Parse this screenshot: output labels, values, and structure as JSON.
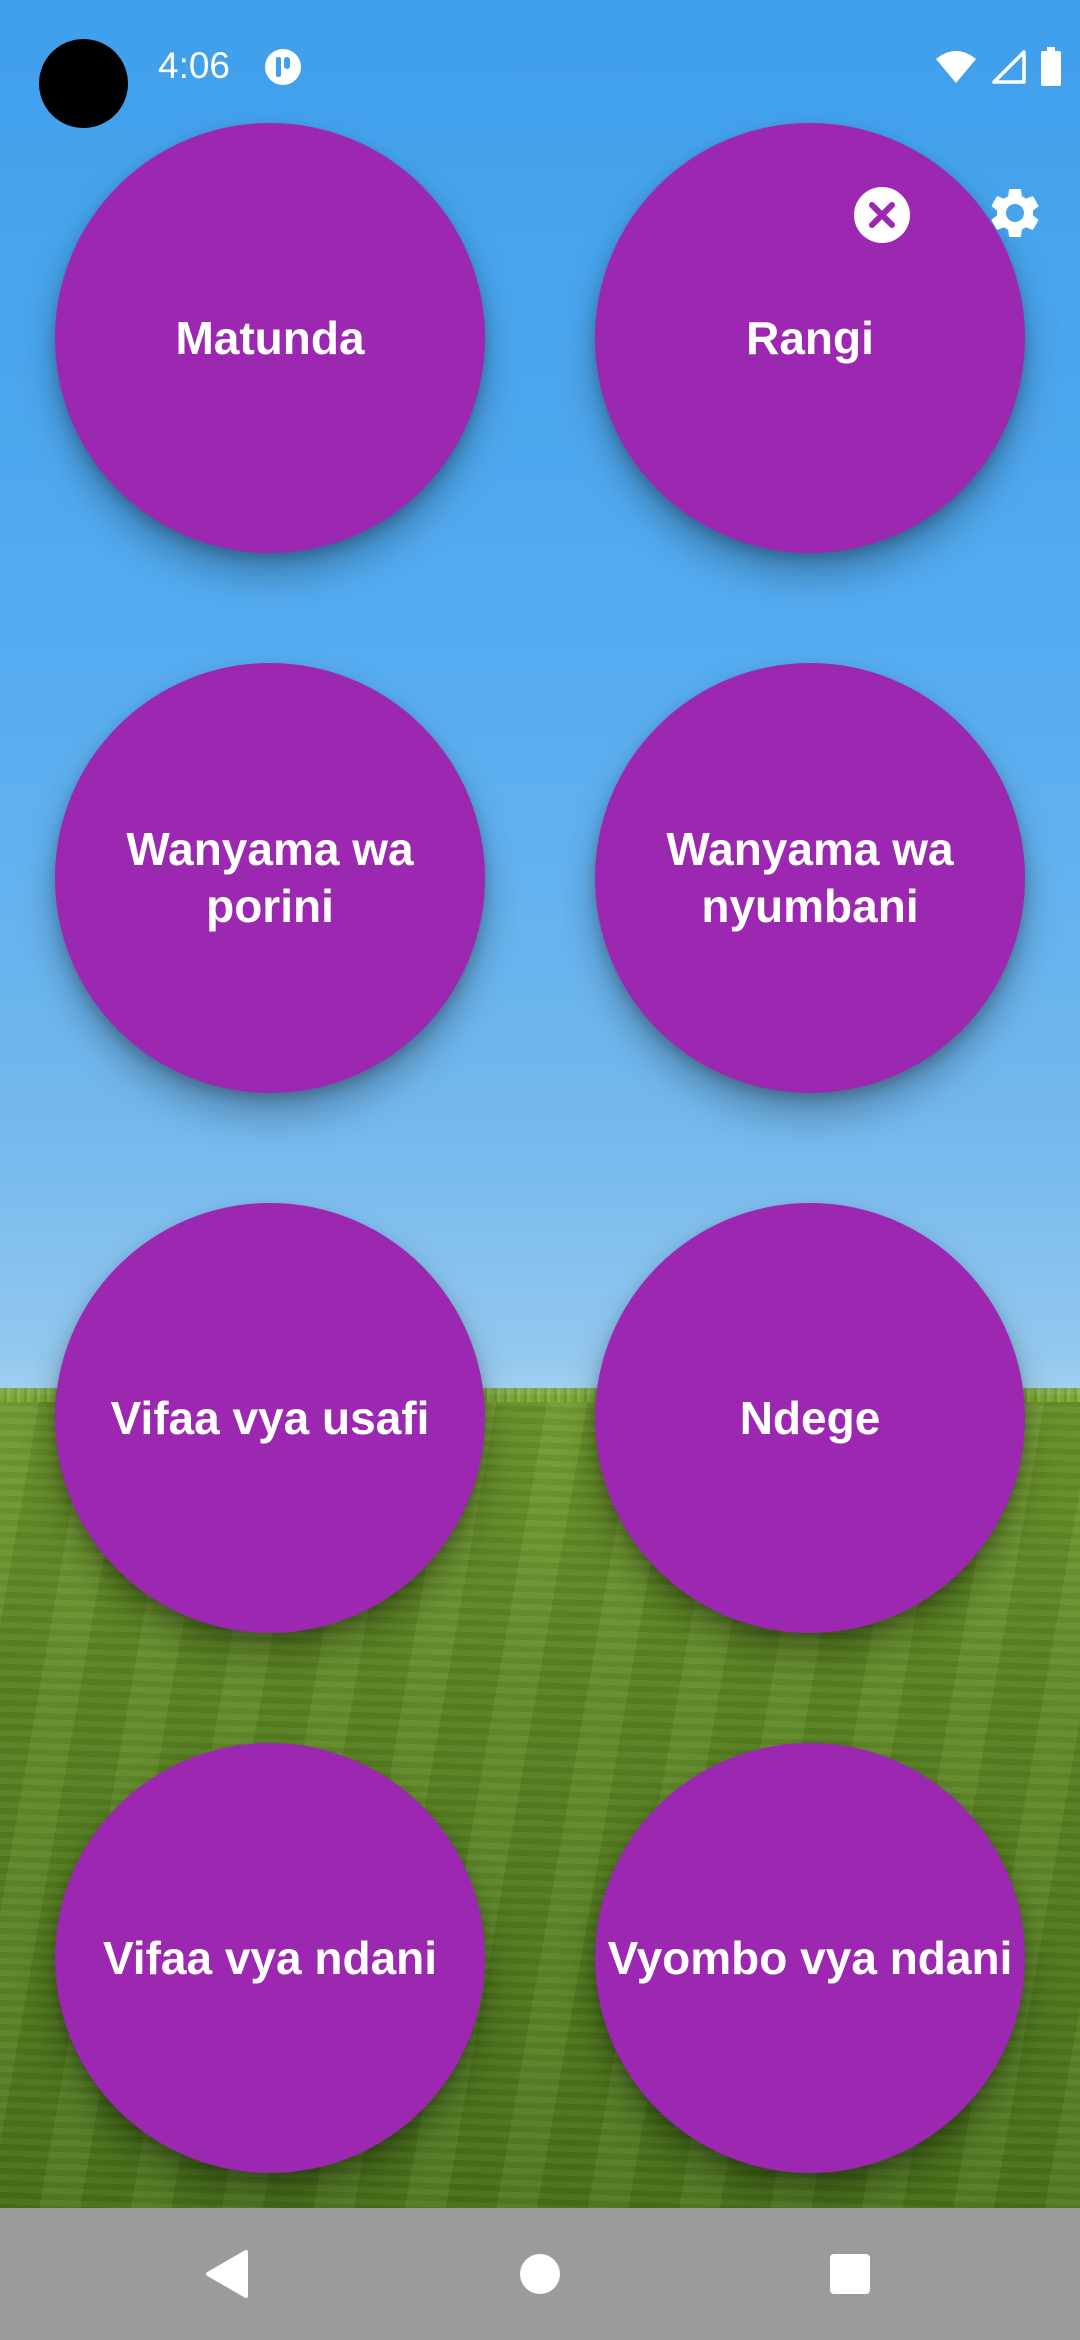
{
  "status_bar": {
    "time": "4:06"
  },
  "icons": {
    "notification": "app-notification-icon",
    "wifi": "wifi-icon",
    "signal": "cellular-signal-icon",
    "battery": "battery-icon",
    "close": "close-icon",
    "settings": "gear-icon"
  },
  "colors": {
    "circle": "#9c27b0",
    "nav_bar": "#9b9b9b"
  },
  "categories": [
    {
      "label": "Matunda"
    },
    {
      "label": "Rangi"
    },
    {
      "label": "Wanyama wa porini"
    },
    {
      "label": "Wanyama wa nyumbani"
    },
    {
      "label": "Vifaa vya usafi"
    },
    {
      "label": "Ndege"
    },
    {
      "label": "Vifaa vya ndani"
    },
    {
      "label": "Vyombo vya ndani"
    }
  ],
  "nav": {
    "back": "back-icon",
    "home": "home-icon",
    "recents": "recents-icon"
  }
}
